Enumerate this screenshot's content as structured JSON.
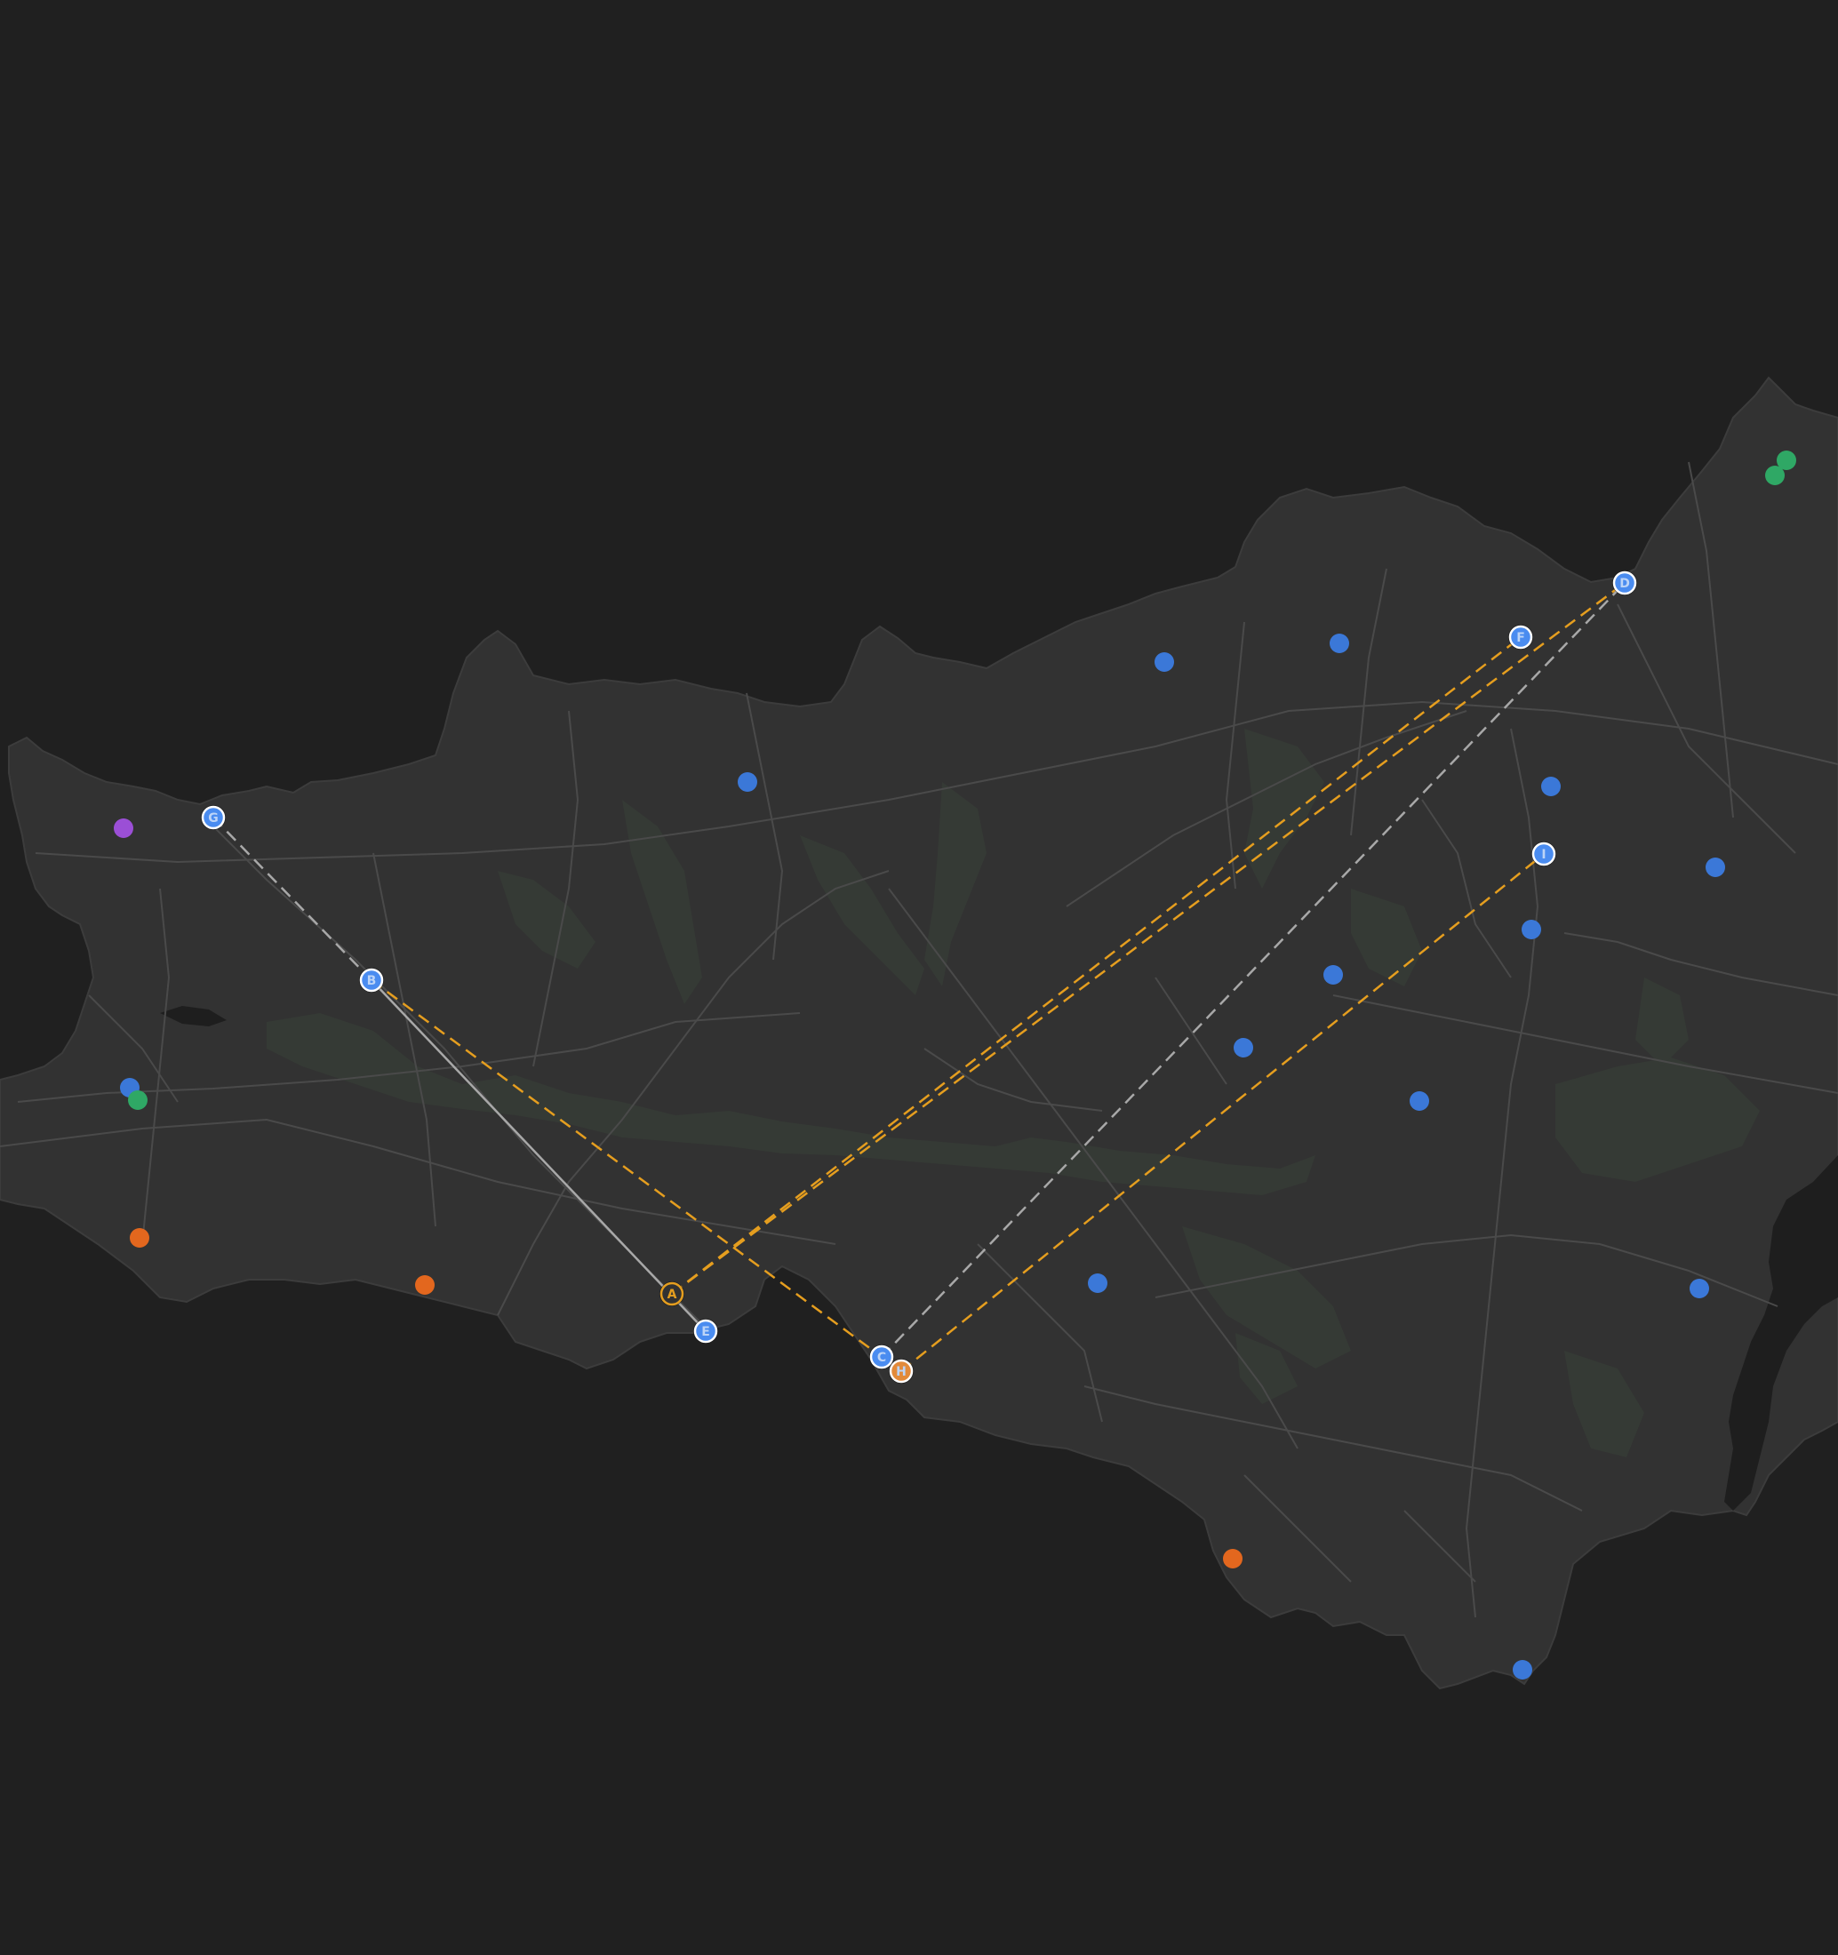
{
  "map": {
    "colors": {
      "background": "#202020",
      "land": "#323232",
      "land_edge": "#3c3c3c",
      "woodland": "#353a35",
      "road": "#4a4a4a",
      "water": "#1e1e1e",
      "route_primary": "#e59e1f",
      "route_secondary": "#a8a8a8",
      "poi_blue": "#3b78d8",
      "poi_orange": "#e3671e",
      "poi_green": "#2fa865",
      "poi_purple": "#9b4fd6",
      "marker_fill": "#4a8cf0",
      "marker_fill_highlight": "#e28a3a",
      "marker_stroke": "#ffffff",
      "marker_letter": "#bcd4f7"
    },
    "markers": [
      {
        "id": "G",
        "label": "G",
        "variant": "blue",
        "icon": "waypoint-pin-icon"
      },
      {
        "id": "B",
        "label": "B",
        "variant": "blue",
        "icon": "waypoint-pin-icon"
      },
      {
        "id": "A",
        "label": "A",
        "variant": "origin",
        "icon": "waypoint-pin-icon"
      },
      {
        "id": "E",
        "label": "E",
        "variant": "blue",
        "icon": "waypoint-pin-icon"
      },
      {
        "id": "C",
        "label": "C",
        "variant": "blue",
        "icon": "waypoint-pin-icon"
      },
      {
        "id": "H",
        "label": "H",
        "variant": "orange",
        "icon": "waypoint-pin-icon"
      },
      {
        "id": "F",
        "label": "F",
        "variant": "blue",
        "icon": "waypoint-pin-icon"
      },
      {
        "id": "D",
        "label": "D",
        "variant": "blue",
        "icon": "waypoint-pin-icon"
      },
      {
        "id": "I",
        "label": "I",
        "variant": "blue",
        "icon": "waypoint-pin-icon"
      }
    ],
    "routes": [
      {
        "from": "G",
        "to": "B",
        "style": "secondary-dashed"
      },
      {
        "from": "B",
        "to": "E",
        "style": "secondary-solid"
      },
      {
        "from": "B",
        "to": "C",
        "style": "primary-dashed"
      },
      {
        "from": "A",
        "to": "F",
        "style": "primary-dashed"
      },
      {
        "from": "A",
        "to": "D",
        "style": "primary-dashed"
      },
      {
        "from": "C",
        "to": "D",
        "style": "secondary-dashed"
      },
      {
        "from": "H",
        "to": "I",
        "style": "primary-dashed"
      }
    ],
    "poi_categories": [
      "blue",
      "orange",
      "green",
      "purple"
    ]
  }
}
